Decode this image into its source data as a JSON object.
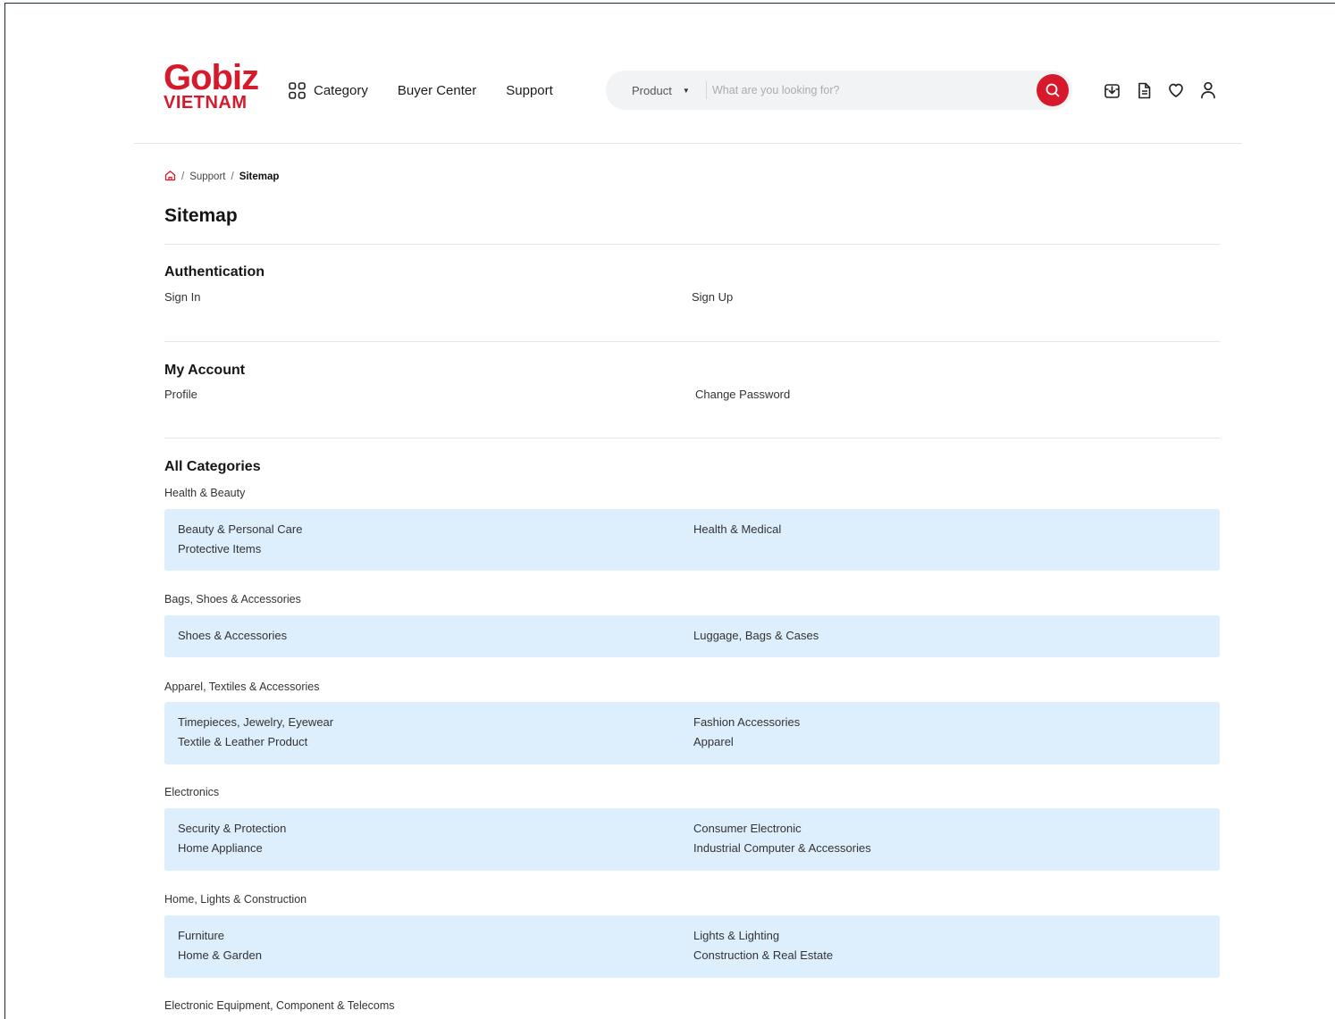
{
  "brand": {
    "logo_top": "Gobiz",
    "logo_bottom": "VIETNAM",
    "accent": "#d7192c"
  },
  "nav": {
    "category": "Category",
    "buyer_center": "Buyer Center",
    "support": "Support"
  },
  "search": {
    "type": "Product",
    "placeholder": "What are you looking for?"
  },
  "header_icons": [
    "download-box-icon",
    "document-icon",
    "heart-icon",
    "user-icon"
  ],
  "breadcrumb": {
    "home_icon": "home-icon",
    "support": "Support",
    "current": "Sitemap"
  },
  "page_title": "Sitemap",
  "authentication": {
    "title": "Authentication",
    "links": [
      "Sign In",
      "Sign Up"
    ]
  },
  "my_account": {
    "title": "My Account",
    "links": [
      "Profile",
      "Change Password"
    ]
  },
  "all_categories": {
    "title": "All Categories",
    "groups": [
      {
        "label": "Health & Beauty",
        "left": [
          "Beauty & Personal Care",
          "Protective Items"
        ],
        "right": [
          "Health & Medical"
        ]
      },
      {
        "label": "Bags, Shoes & Accessories",
        "left": [
          "Shoes & Accessories"
        ],
        "right": [
          "Luggage, Bags & Cases"
        ]
      },
      {
        "label": "Apparel, Textiles & Accessories",
        "left": [
          "Timepieces, Jewelry, Eyewear",
          "Textile & Leather Product"
        ],
        "right": [
          "Fashion Accessories",
          "Apparel"
        ]
      },
      {
        "label": "Electronics",
        "left": [
          "Security & Protection",
          "Home Appliance"
        ],
        "right": [
          "Consumer Electronic",
          "Industrial Computer & Accessories"
        ]
      },
      {
        "label": "Home, Lights & Construction",
        "left": [
          "Furniture",
          "Home & Garden"
        ],
        "right": [
          "Lights & Lighting",
          "Construction & Real Estate"
        ]
      },
      {
        "label": "Electronic Equipment, Component & Telecoms",
        "left": [],
        "right": []
      }
    ]
  }
}
